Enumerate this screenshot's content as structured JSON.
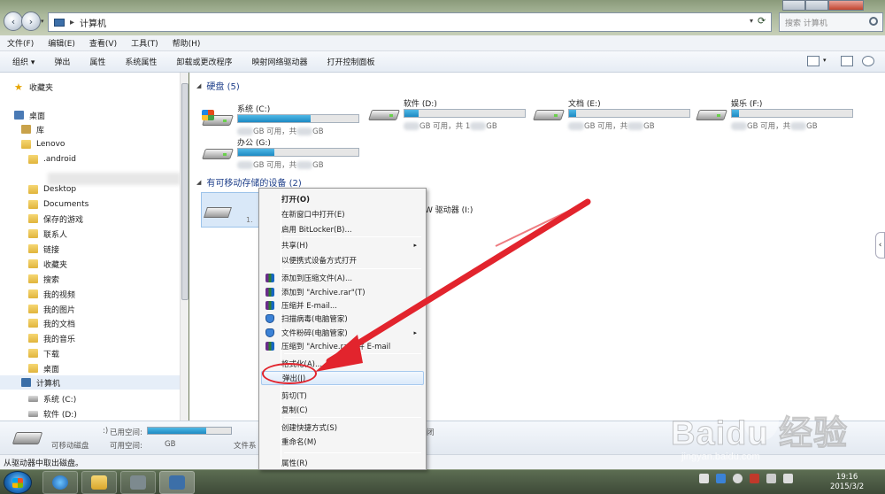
{
  "window": {
    "address": "计算机",
    "search_placeholder": "搜索 计算机",
    "back_icon": "‹",
    "fwd_icon": "›",
    "address_sep": "▸",
    "dropdown_icon": "▾",
    "refresh_icon": "⟳",
    "menu_dropdown_icon": "▾"
  },
  "menubar": {
    "items": [
      "文件(F)",
      "编辑(E)",
      "查看(V)",
      "工具(T)",
      "帮助(H)"
    ]
  },
  "toolbar": {
    "items": [
      "组织 ▾",
      "弹出",
      "属性",
      "系统属性",
      "卸载或更改程序",
      "映射网络驱动器",
      "打开控制面板"
    ]
  },
  "navpane": {
    "favorites": "收藏夹",
    "desktop": "桌面",
    "libraries": "库",
    "items": [
      "Lenovo",
      ".android",
      "Desktop",
      "Documents",
      "保存的游戏",
      "联系人",
      "链接",
      "收藏夹",
      "搜索",
      "我的视频",
      "我的图片",
      "我的文档",
      "我的音乐",
      "下载",
      "桌面"
    ],
    "computer": "计算机",
    "drives": [
      "系统 (C:)",
      "软件 (D:)"
    ]
  },
  "content": {
    "hdd_header": "硬盘 (5)",
    "removable_header": "有可移动存储的设备 (2)",
    "drives": [
      {
        "name": "系统 (C:)",
        "free": "GB 可用，共",
        "total": "GB",
        "fill_pct": 60,
        "system": true
      },
      {
        "name": "软件 (D:)",
        "free": "GB 可用，共 1",
        "total": "GB",
        "fill_pct": 12,
        "system": false
      },
      {
        "name": "文档 (E:)",
        "free": "GB 可用，共",
        "total": "GB",
        "fill_pct": 6,
        "system": false
      },
      {
        "name": "娱乐 (F:)",
        "free": "GB 可用，共",
        "total": "GB",
        "fill_pct": 6,
        "system": false
      },
      {
        "name": "办公 (G:)",
        "free": "GB 可用，共",
        "total": "GB",
        "fill_pct": 30,
        "system": false
      }
    ],
    "removable_info": "1.",
    "dvd_label": "W 驱动器 (I:)"
  },
  "details": {
    "drive_suffix": ":)",
    "used_label": "已用空间:",
    "type": "可移动磁盘",
    "free_label": "可用空间:",
    "free_unit": "GB",
    "fs_label": "文件系",
    "extra": "闭"
  },
  "statusbar": {
    "text": "从驱动器中取出磁盘。"
  },
  "context_menu": {
    "items": [
      {
        "label": "打开(O)",
        "bold": true
      },
      {
        "label": "在新窗口中打开(E)"
      },
      {
        "label": "启用 BitLocker(B)..."
      },
      {
        "label": "共享(H)",
        "sub": "▸"
      },
      {
        "label": "以便携式设备方式打开"
      },
      {
        "label": "添加到压缩文件(A)...",
        "icon": "rar"
      },
      {
        "label": "添加到 \"Archive.rar\"(T)",
        "icon": "rar"
      },
      {
        "label": "压缩并 E-mail...",
        "icon": "rar"
      },
      {
        "label": "扫描病毒(电脑管家)",
        "icon": "shield"
      },
      {
        "label": "文件粉碎(电脑管家)",
        "icon": "shield",
        "sub": "▸"
      },
      {
        "label": "压缩到 \"Archive.rar\" 并 E-mail",
        "icon": "rar"
      },
      {
        "label": "格式化(A)..."
      },
      {
        "label": "弹出(J)",
        "highlight": true
      },
      {
        "label": "剪切(T)"
      },
      {
        "label": "复制(C)"
      },
      {
        "label": "创建快捷方式(S)"
      },
      {
        "label": "重命名(M)"
      },
      {
        "label": "属性(R)"
      }
    ]
  },
  "taskbar": {
    "time": "19:16",
    "date": "2015/3/2"
  },
  "watermark": {
    "brand": "Baidu 经验",
    "url": "jingyan.baidu.com"
  },
  "colors": {
    "annotation_red": "#e2242d",
    "drive_bar": "#1d8ac3",
    "header_blue": "#1e3f8a"
  }
}
